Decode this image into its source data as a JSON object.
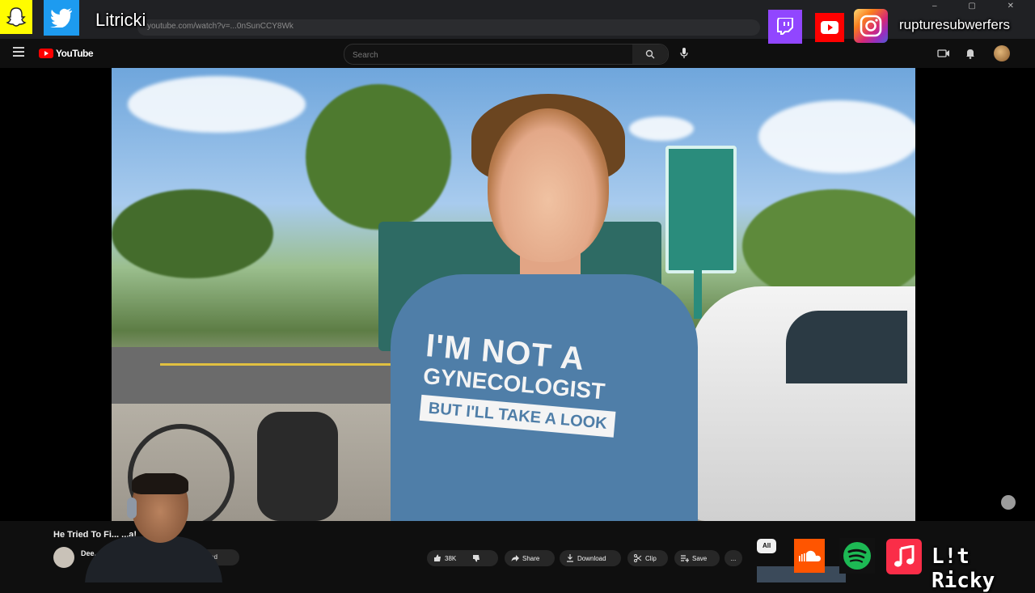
{
  "browser": {
    "url": "youtube.com/watch?v=...0nSunCCY8Wk",
    "window_controls": [
      "–",
      "▢",
      "✕"
    ]
  },
  "youtube_header": {
    "logo_text": "YouTube",
    "search_placeholder": "Search"
  },
  "video": {
    "shirt_line_1": "I'M NOT A",
    "shirt_line_2": "GYNECOLOGIST",
    "shirt_line_3": "BUT I'LL TAKE A LOOK"
  },
  "below_video": {
    "title": "He Tried To Fi... ...a!",
    "channel": "Dee...",
    "subscribe_label": "ed",
    "like_count": "38K",
    "share_label": "Share",
    "download_label": "Download",
    "clip_label": "Clip",
    "save_label": "Save",
    "more_label": "...",
    "chip_all": "All"
  },
  "overlay": {
    "top_left_name": "Litricki",
    "top_right_name": "rupturesubwerfers",
    "bottom_right_name": "L!t Ricky"
  },
  "colors": {
    "snapchat": "#fffc00",
    "twitter": "#1d9bf0",
    "twitch": "#9146ff",
    "youtube": "#ff0000",
    "instagram": "#d6249f",
    "soundcloud": "#ff5500",
    "spotify": "#1db954",
    "apple_music": "#fa2d48"
  }
}
